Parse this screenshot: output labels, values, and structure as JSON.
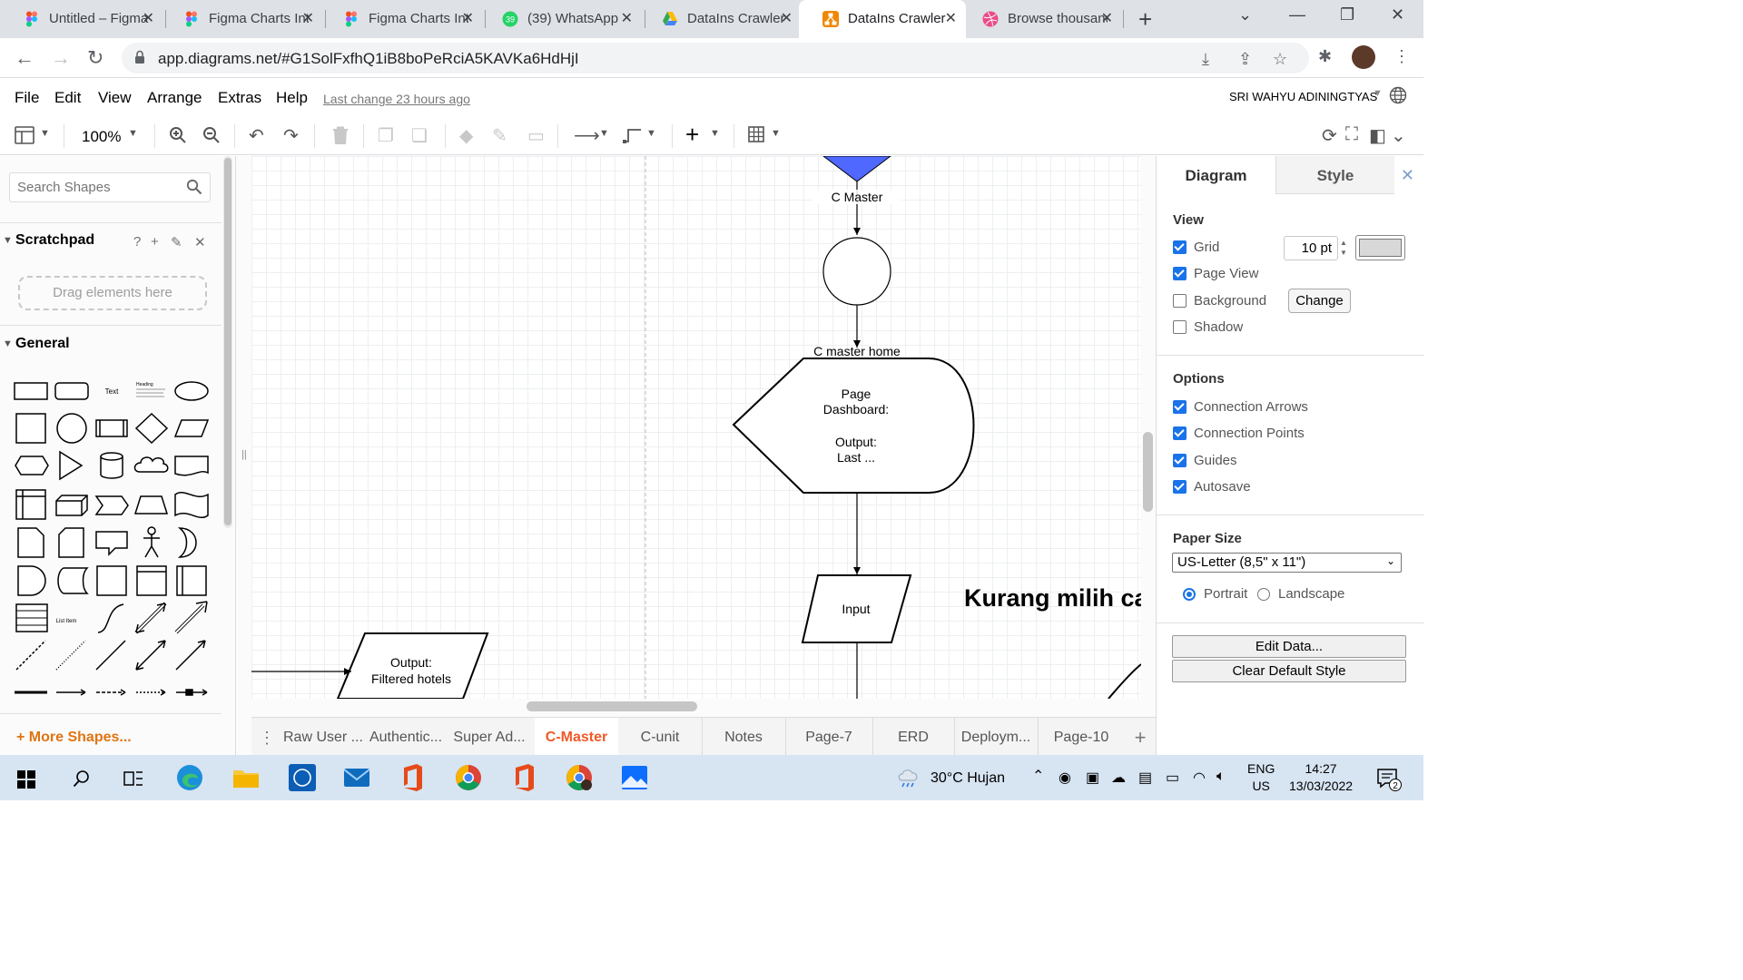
{
  "browser": {
    "tabs": [
      {
        "title": "Untitled – Figma",
        "icon": "figma-icon"
      },
      {
        "title": "Figma Charts Intro",
        "icon": "figma-icon"
      },
      {
        "title": "Figma Charts Intro",
        "icon": "figma-icon"
      },
      {
        "title": "(39) WhatsApp",
        "icon": "whatsapp-icon",
        "badge": "39"
      },
      {
        "title": "DataIns Crawler",
        "icon": "google-drive-icon"
      },
      {
        "title": "DataIns Crawler",
        "icon": "drawio-icon",
        "active": true
      },
      {
        "title": "Browse thousands",
        "icon": "dribbble-icon"
      }
    ],
    "url": "app.diagrams.net/#G1SolFxfhQ1iB8boPeRciA5KAVKa6HdHjI"
  },
  "app": {
    "menu": [
      "File",
      "Edit",
      "View",
      "Arrange",
      "Extras",
      "Help"
    ],
    "last_change": "Last change 23 hours ago",
    "user": "SRI WAHYU ADININGTYAS",
    "zoom": "100%"
  },
  "sidebar": {
    "search_placeholder": "Search Shapes",
    "scratchpad": {
      "title": "Scratchpad",
      "help": "?",
      "dropzone": "Drag elements here"
    },
    "general": {
      "title": "General",
      "text_shape": "Text",
      "heading_shape": "Heading",
      "list_item_shape": "List Item"
    },
    "more_shapes": "More Shapes..."
  },
  "diagram": {
    "labels": {
      "c_master": "C Master",
      "c_master_home": "C master home",
      "page_dashboard": [
        "Page",
        "Dashboard:",
        "",
        "Output:",
        "Last ..."
      ],
      "input": "Input",
      "output": [
        "Output:",
        "Filtered hotels"
      ],
      "big_text": "Kurang milih ca"
    },
    "colors": {
      "triangle": "#4f68ff",
      "stroke": "#000000"
    }
  },
  "pages": {
    "tabs": [
      "Raw User ...",
      "Authentic...",
      "Super Ad...",
      "C-Master",
      "C-unit",
      "Notes",
      "Page-7",
      "ERD",
      "Deploym...",
      "Page-10"
    ],
    "active": "C-Master"
  },
  "format_panel": {
    "tabs": {
      "diagram": "Diagram",
      "style": "Style"
    },
    "view": {
      "title": "View",
      "grid": {
        "label": "Grid",
        "checked": true,
        "size": "10 pt"
      },
      "page_view": {
        "label": "Page View",
        "checked": true
      },
      "background": {
        "label": "Background",
        "checked": false,
        "button": "Change"
      },
      "shadow": {
        "label": "Shadow",
        "checked": false
      }
    },
    "options": {
      "title": "Options",
      "items": [
        {
          "label": "Connection Arrows",
          "checked": true
        },
        {
          "label": "Connection Points",
          "checked": true
        },
        {
          "label": "Guides",
          "checked": true
        },
        {
          "label": "Autosave",
          "checked": true
        }
      ]
    },
    "paper_size": {
      "title": "Paper Size",
      "selected": "US-Letter (8,5\" x 11\")",
      "portrait": "Portrait",
      "landscape": "Landscape",
      "orientation": "portrait"
    },
    "buttons": {
      "edit_data": "Edit Data...",
      "clear_style": "Clear Default Style"
    }
  },
  "taskbar": {
    "weather": "30°C  Hujan",
    "lang_top": "ENG",
    "lang_bottom": "US",
    "time": "14:27",
    "date": "13/03/2022",
    "notif_count": "2"
  }
}
